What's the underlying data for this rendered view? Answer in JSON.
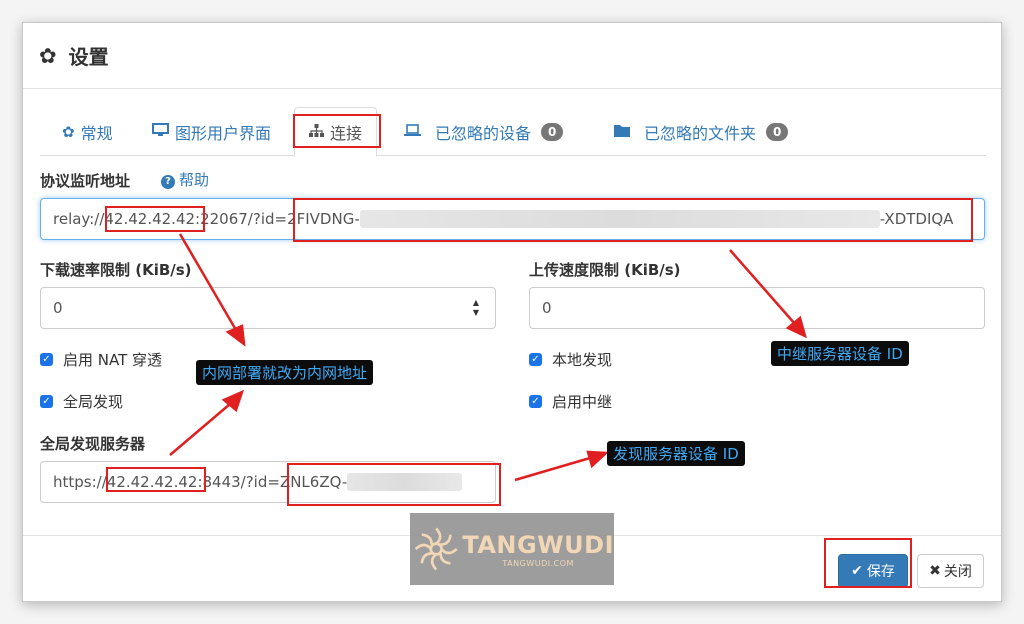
{
  "modal": {
    "title": "设置"
  },
  "tabs": [
    {
      "label": "常规",
      "icon": "gear-icon"
    },
    {
      "label": "图形用户界面",
      "icon": "monitor-icon"
    },
    {
      "label": "连接",
      "icon": "sitemap-icon"
    },
    {
      "label": "已忽略的设备",
      "icon": "laptop-icon",
      "badge": "0"
    },
    {
      "label": "已忽略的文件夹",
      "icon": "folder-icon",
      "badge": "0"
    }
  ],
  "protocol": {
    "label": "协议监听地址",
    "help": "帮助",
    "value_prefix": "relay://",
    "value_ip": "42.42.42.42",
    "value_mid": ":22067/?id=",
    "value_id_start": "2FIVDNG-",
    "value_id_end": "-XDTDIQA"
  },
  "download": {
    "label": "下载速率限制 (KiB/s)",
    "value": "0"
  },
  "upload": {
    "label": "上传速度限制 (KiB/s)",
    "value": "0"
  },
  "checks": {
    "nat": "启用 NAT 穿透",
    "global": "全局发现",
    "local": "本地发现",
    "relay": "启用中继"
  },
  "discovery": {
    "label": "全局发现服务器",
    "value_prefix": "https://",
    "value_ip": "42.42.42.42",
    "value_mid": ":8443/?id=",
    "value_id_start": "ZNL6ZQ-"
  },
  "footer": {
    "save": "保存",
    "close": "关闭"
  },
  "annotations": {
    "intranet": "内网部署就改为内网地址",
    "relay_id": "中继服务器设备 ID",
    "discovery_id": "发现服务器设备 ID"
  },
  "watermark": {
    "main": "TANGWUDI",
    "sub": "TANGWUDI.COM"
  },
  "colors": {
    "accent": "#337ab7",
    "annotation_red": "#e02020",
    "callout_text": "#3fa9f5"
  }
}
